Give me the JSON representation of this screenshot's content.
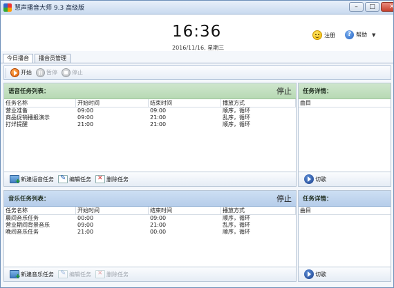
{
  "window": {
    "title": "慧声播音大师 9.3 高级版",
    "controls": {
      "minimize": "–",
      "maximize": "□",
      "close": "✕"
    }
  },
  "header": {
    "time": "16:36",
    "date": "2016/11/16, 星期三",
    "register_label": "注册",
    "help_label": "帮助"
  },
  "tabs": [
    {
      "label": "今日播音",
      "active": true
    },
    {
      "label": "播音员管理",
      "active": false
    }
  ],
  "toolbar": {
    "start_label": "开始",
    "pause_label": "暂停",
    "stop_label": "停止"
  },
  "voice_panel": {
    "title": "语音任务列表：",
    "status": "停止",
    "columns": [
      "任务名称",
      "开始时间",
      "结束时间",
      "播放方式"
    ],
    "rows": [
      [
        "营业准备",
        "09:00",
        "09:00",
        "顺序，循环"
      ],
      [
        "商品促销播报演示",
        "09:00",
        "21:00",
        "乱序，循环"
      ],
      [
        "打烊提醒",
        "21:00",
        "21:00",
        "顺序，循环"
      ]
    ],
    "footer": {
      "add_label": "新建语音任务",
      "edit_label": "编辑任务",
      "delete_label": "删除任务"
    }
  },
  "voice_detail": {
    "title": "任务详情：",
    "column": "曲目",
    "footer_label": "切歌"
  },
  "music_panel": {
    "title": "音乐任务列表：",
    "status": "停止",
    "columns": [
      "任务名称",
      "开始时间",
      "结束时间",
      "播放方式"
    ],
    "rows": [
      [
        "晨间音乐任务",
        "00:00",
        "09:00",
        "顺序，循环"
      ],
      [
        "营业期间背景音乐",
        "09:00",
        "21:00",
        "乱序，循环"
      ],
      [
        "晚间音乐任务",
        "21:00",
        "00:00",
        "顺序，循环"
      ]
    ],
    "footer": {
      "add_label": "新建音乐任务",
      "edit_label": "编辑任务",
      "delete_label": "删除任务"
    }
  },
  "music_detail": {
    "title": "任务详情：",
    "column": "曲目",
    "footer_label": "切歌"
  },
  "colors": {
    "voice_header": "#b7d9b4",
    "music_header": "#b6cdea",
    "start_icon": "#e05a00"
  }
}
